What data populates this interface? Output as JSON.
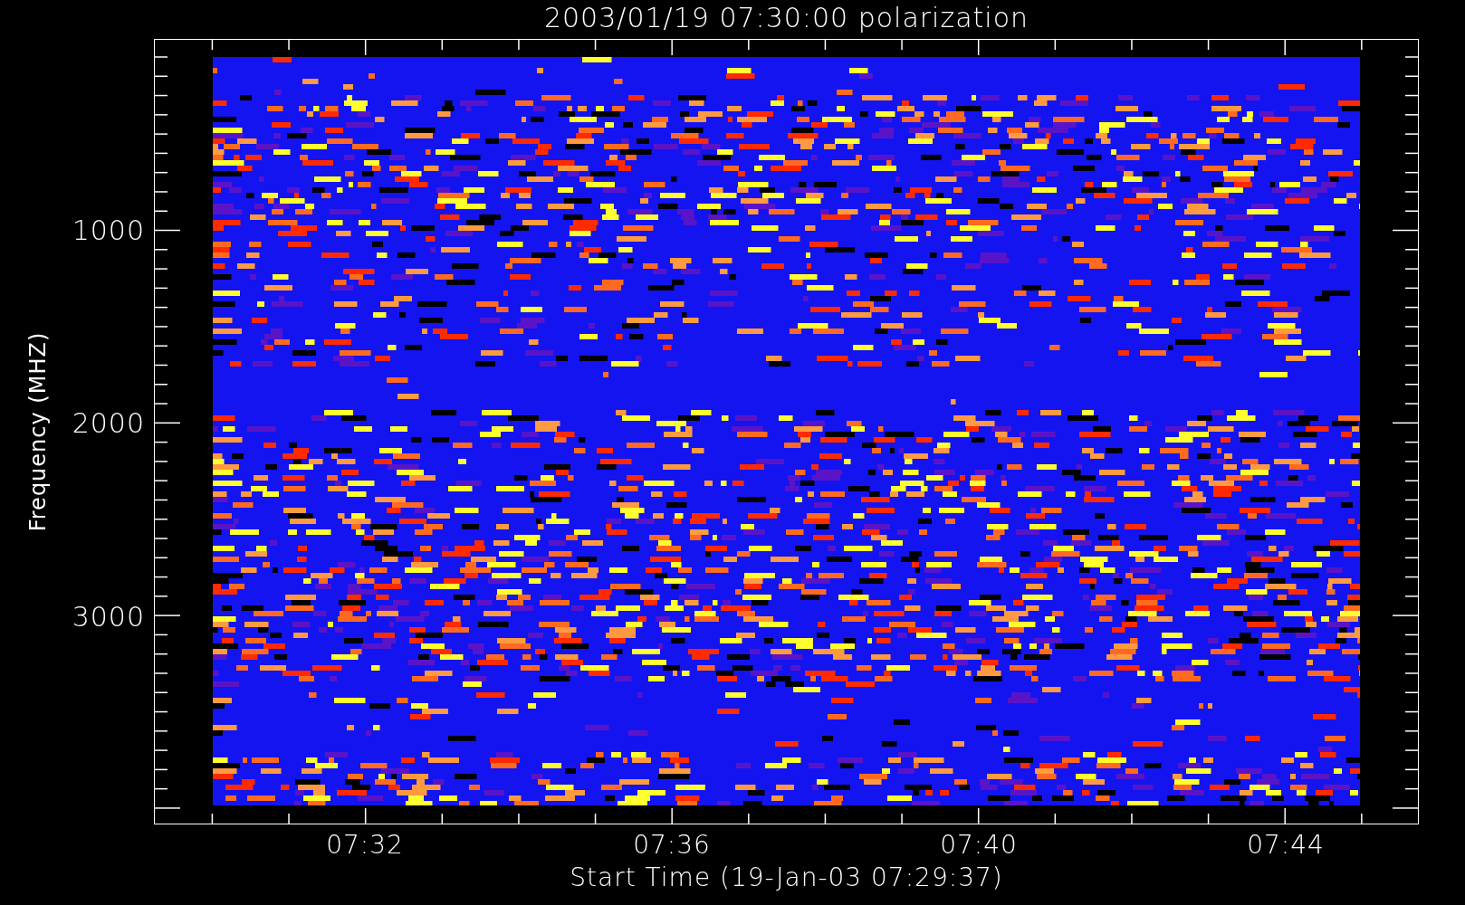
{
  "title": "2003/01/19 07:30:00 polarization",
  "ylabel": "Frequency (MHZ)",
  "xlabel": "Start Time (19-Jan-03 07:29:37)",
  "yticks": [
    "1000",
    "2000",
    "3000"
  ],
  "xticks": [
    "07:32",
    "07:36",
    "07:40",
    "07:44"
  ]
}
